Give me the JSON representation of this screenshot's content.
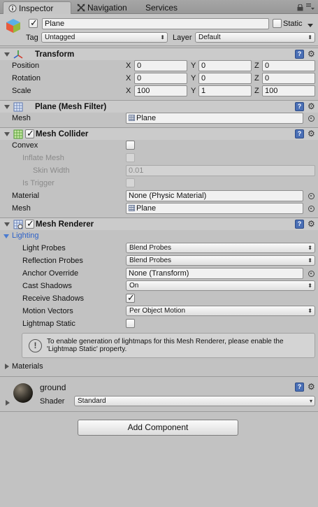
{
  "tabs": {
    "inspector": "Inspector",
    "navigation": "Navigation",
    "services": "Services"
  },
  "header": {
    "object_name": "Plane",
    "object_active": true,
    "static_label": "Static",
    "static_checked": false,
    "tag_label": "Tag",
    "tag_value": "Untagged",
    "layer_label": "Layer",
    "layer_value": "Default"
  },
  "transform": {
    "title": "Transform",
    "position_label": "Position",
    "rotation_label": "Rotation",
    "scale_label": "Scale",
    "axis_x": "X",
    "axis_y": "Y",
    "axis_z": "Z",
    "position": [
      "0",
      "0",
      "0"
    ],
    "rotation": [
      "0",
      "0",
      "0"
    ],
    "scale": [
      "100",
      "1",
      "100"
    ]
  },
  "mesh_filter": {
    "title": "Plane (Mesh Filter)",
    "mesh_label": "Mesh",
    "mesh_value": "Plane"
  },
  "mesh_collider": {
    "title": "Mesh Collider",
    "enabled": true,
    "convex_label": "Convex",
    "inflate_mesh_label": "Inflate Mesh",
    "skin_width_label": "Skin Width",
    "skin_width_value": "0.01",
    "is_trigger_label": "Is Trigger",
    "material_label": "Material",
    "material_value": "None (Physic Material)",
    "mesh_label": "Mesh",
    "mesh_value": "Plane"
  },
  "mesh_renderer": {
    "title": "Mesh Renderer",
    "enabled": true,
    "lighting_label": "Lighting",
    "light_probes_label": "Light Probes",
    "light_probes_value": "Blend Probes",
    "reflection_probes_label": "Reflection Probes",
    "reflection_probes_value": "Blend Probes",
    "anchor_override_label": "Anchor Override",
    "anchor_override_value": "None (Transform)",
    "cast_shadows_label": "Cast Shadows",
    "cast_shadows_value": "On",
    "receive_shadows_label": "Receive Shadows",
    "receive_shadows_checked": true,
    "motion_vectors_label": "Motion Vectors",
    "motion_vectors_value": "Per Object Motion",
    "lightmap_static_label": "Lightmap Static",
    "lightmap_static_checked": false,
    "help_text_line1": "To enable generation of lightmaps for this Mesh Renderer, please enable the",
    "help_text_line2": "'Lightmap Static' property.",
    "materials_label": "Materials"
  },
  "material": {
    "name": "ground",
    "shader_label": "Shader",
    "shader_value": "Standard"
  },
  "add_component_label": "Add Component",
  "icons": {
    "lock": "lock-icon",
    "menu": "context-menu-icon",
    "help": "help-icon",
    "settings": "gear-icon",
    "object_picker": "object-picker-icon"
  }
}
